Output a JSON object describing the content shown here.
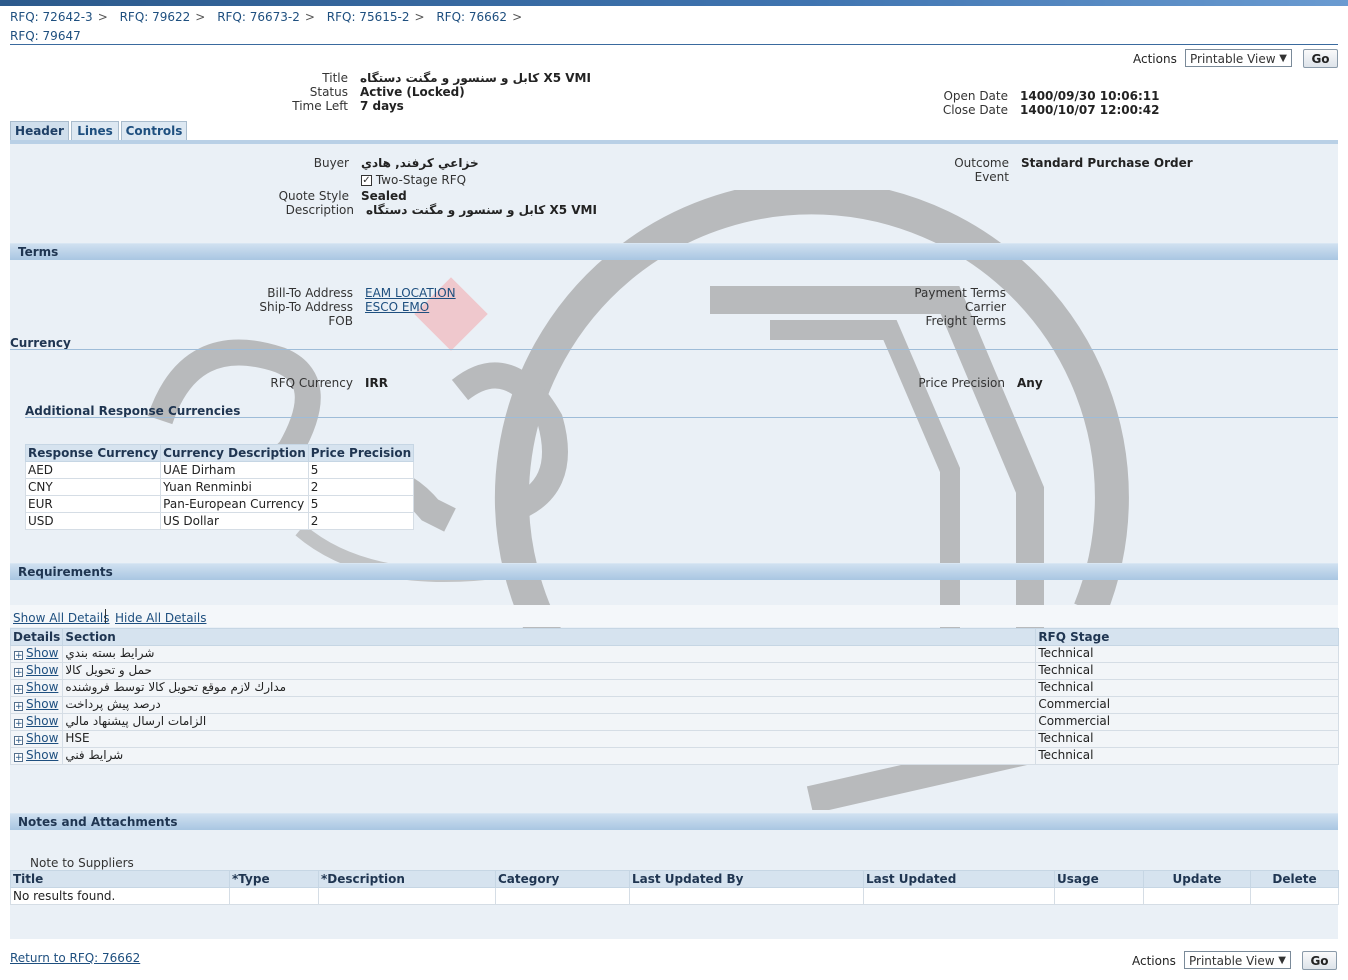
{
  "breadcrumbs": [
    "RFQ: 72642-3",
    "RFQ: 79622",
    "RFQ: 76673-2",
    "RFQ: 75615-2",
    "RFQ: 76662"
  ],
  "page_title": "RFQ: 79647",
  "actions": {
    "label": "Actions",
    "select_value": "Printable View",
    "go_label": "Go"
  },
  "header": {
    "title_label": "Title",
    "title_value": "کابل و سنسور و مگنت دستگاه X5 VMI",
    "status_label": "Status",
    "status_value": "Active (Locked)",
    "time_left_label": "Time Left",
    "time_left_value": "7 days",
    "open_date_label": "Open Date",
    "open_date_value": "1400/09/30 10:06:11",
    "close_date_label": "Close Date",
    "close_date_value": "1400/10/07 12:00:42"
  },
  "tabs": [
    {
      "label": "Header"
    },
    {
      "label": "Lines"
    },
    {
      "label": "Controls"
    }
  ],
  "header_tab": {
    "buyer_label": "Buyer",
    "buyer_value": "خزاعي كرفند, هادي",
    "two_stage_label": "Two-Stage RFQ",
    "quote_style_label": "Quote Style",
    "quote_style_value": "Sealed",
    "description_label": "Description",
    "description_value": "کابل و سنسور و مگنت دستگاه X5 VMI",
    "outcome_label": "Outcome",
    "outcome_value": "Standard Purchase Order",
    "event_label": "Event"
  },
  "terms": {
    "section_title": "Terms",
    "bill_to_label": "Bill-To Address",
    "bill_to_value": "EAM LOCATION",
    "ship_to_label": "Ship-To Address",
    "ship_to_value": "ESCO EMO",
    "fob_label": "FOB",
    "payment_terms_label": "Payment Terms",
    "carrier_label": "Carrier",
    "freight_terms_label": "Freight Terms"
  },
  "currency": {
    "section_title": "Currency",
    "rfq_currency_label": "RFQ Currency",
    "rfq_currency_value": "IRR",
    "price_precision_label": "Price Precision",
    "price_precision_value": "Any",
    "additional_title": "Additional Response Currencies",
    "columns": [
      "Response Currency",
      "Currency Description",
      "Price Precision"
    ],
    "rows": [
      [
        "AED",
        "UAE Dirham",
        "5"
      ],
      [
        "CNY",
        "Yuan Renminbi",
        "2"
      ],
      [
        "EUR",
        "Pan-European Currency",
        "5"
      ],
      [
        "USD",
        "US Dollar",
        "2"
      ]
    ]
  },
  "requirements": {
    "section_title": "Requirements",
    "show_all": "Show All Details",
    "hide_all": "Hide All Details",
    "columns": [
      "Details",
      "Section",
      "RFQ Stage"
    ],
    "show_label": "Show",
    "rows": [
      {
        "section": "شرايط بسته بندي",
        "stage": "Technical"
      },
      {
        "section": "حمل و تحويل كالا",
        "stage": "Technical"
      },
      {
        "section": "مدارك لازم موقع تحويل كالا توسط فروشنده",
        "stage": "Technical"
      },
      {
        "section": "درصد پيش پرداخت",
        "stage": "Commercial"
      },
      {
        "section": "الزامات ارسال پيشنهاد مالي",
        "stage": "Commercial"
      },
      {
        "section": "HSE",
        "stage": "Technical"
      },
      {
        "section": "شرايط فني",
        "stage": "Technical"
      }
    ]
  },
  "notes": {
    "section_title": "Notes and Attachments",
    "note_to_suppliers_label": "Note to Suppliers",
    "columns": [
      "Title",
      "*Type",
      "*Description",
      "Category",
      "Last Updated By",
      "Last Updated",
      "Usage",
      "Update",
      "Delete"
    ],
    "empty_message": "No results found."
  },
  "footer": {
    "return_link": "Return to RFQ: 76662"
  },
  "colors": {
    "link": "#1e4f7f",
    "section_bar": "#a9c6e2",
    "panel_bg": "#eaf0f6",
    "top_bar": "#3f74b0"
  }
}
